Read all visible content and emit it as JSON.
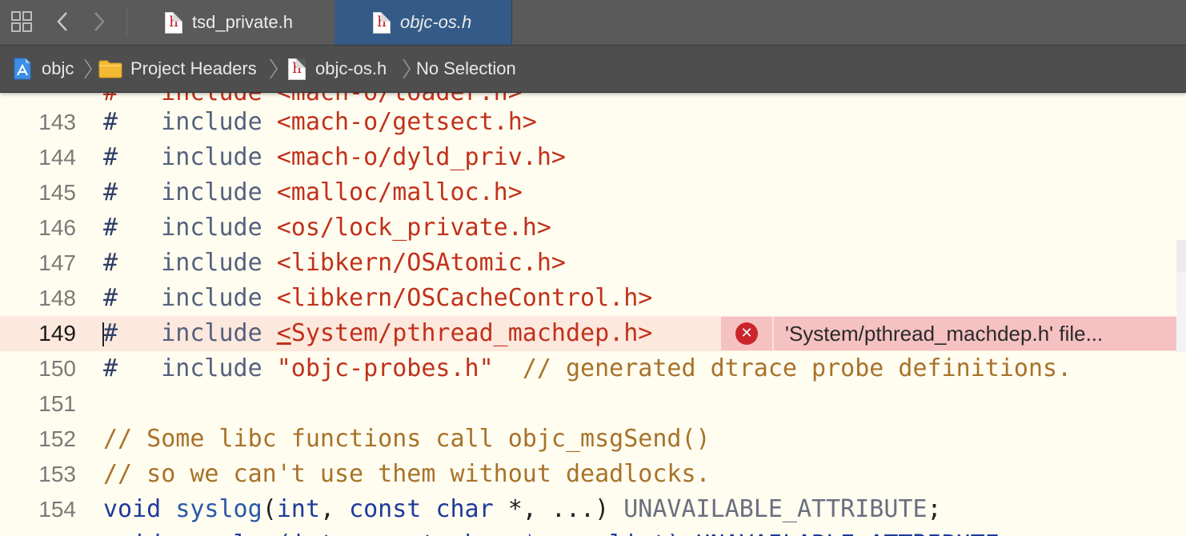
{
  "tabs": [
    {
      "label": "tsd_private.h",
      "icon": "header-file-icon",
      "active": false
    },
    {
      "label": "objc-os.h",
      "icon": "header-file-icon",
      "active": true
    }
  ],
  "jumpbar": {
    "project": "objc",
    "group": "Project Headers",
    "file": "objc-os.h",
    "symbol": "No Selection"
  },
  "file_icon_letter": "h",
  "error": {
    "line": 149,
    "message": "'System/pthread_machdep.h' file..."
  },
  "colors": {
    "tabbar": "#5a5a5a",
    "active_tab": "#345b87",
    "editor_bg": "#fffdf0",
    "current_line": "#fde8dd",
    "error_bg": "#f6c1c1",
    "error_icon": "#c9252b",
    "string": "#c1311b",
    "comment": "#a8722a",
    "keyword": "#1f3a9a"
  },
  "code": {
    "partial_top": "#   include <mach-o/loader.h>",
    "l143": {
      "num": "143",
      "hash": "#",
      "kw": "include",
      "arg": "<mach-o/getsect.h>"
    },
    "l144": {
      "num": "144",
      "hash": "#",
      "kw": "include",
      "arg": "<mach-o/dyld_priv.h>"
    },
    "l145": {
      "num": "145",
      "hash": "#",
      "kw": "include",
      "arg": "<malloc/malloc.h>"
    },
    "l146": {
      "num": "146",
      "hash": "#",
      "kw": "include",
      "arg": "<os/lock_private.h>"
    },
    "l147": {
      "num": "147",
      "hash": "#",
      "kw": "include",
      "arg": "<libkern/OSAtomic.h>"
    },
    "l148": {
      "num": "148",
      "hash": "#",
      "kw": "include",
      "arg": "<libkern/OSCacheControl.h>"
    },
    "l149": {
      "num": "149",
      "hash": "#",
      "kw": "include",
      "arg_first": "<",
      "arg_rest": "System/pthread_machdep.h>"
    },
    "l150": {
      "num": "150",
      "hash": "#",
      "kw": "include",
      "arg": "\"objc-probes.h\"",
      "comment": "// generated dtrace probe definitions."
    },
    "l151": {
      "num": "151"
    },
    "l152": {
      "num": "152",
      "comment": "// Some libc functions call objc_msgSend()"
    },
    "l153": {
      "num": "153",
      "comment": "// so we can't use them without deadlocks."
    },
    "l154": {
      "num": "154",
      "kw_void": "void",
      "fn": "syslog",
      "open": "(",
      "kw_int": "int",
      "comma1": ", ",
      "kw_const": "const",
      "sp": " ",
      "kw_char": "char",
      "rest": " *, ...) ",
      "macro": "UNAVAILABLE_ATTRIBUTE",
      "semi": ";"
    },
    "partial_bottom": "void vsyslog(int, const char *, va_list) UNAVAILABLE_ATTRIBUTE;"
  }
}
